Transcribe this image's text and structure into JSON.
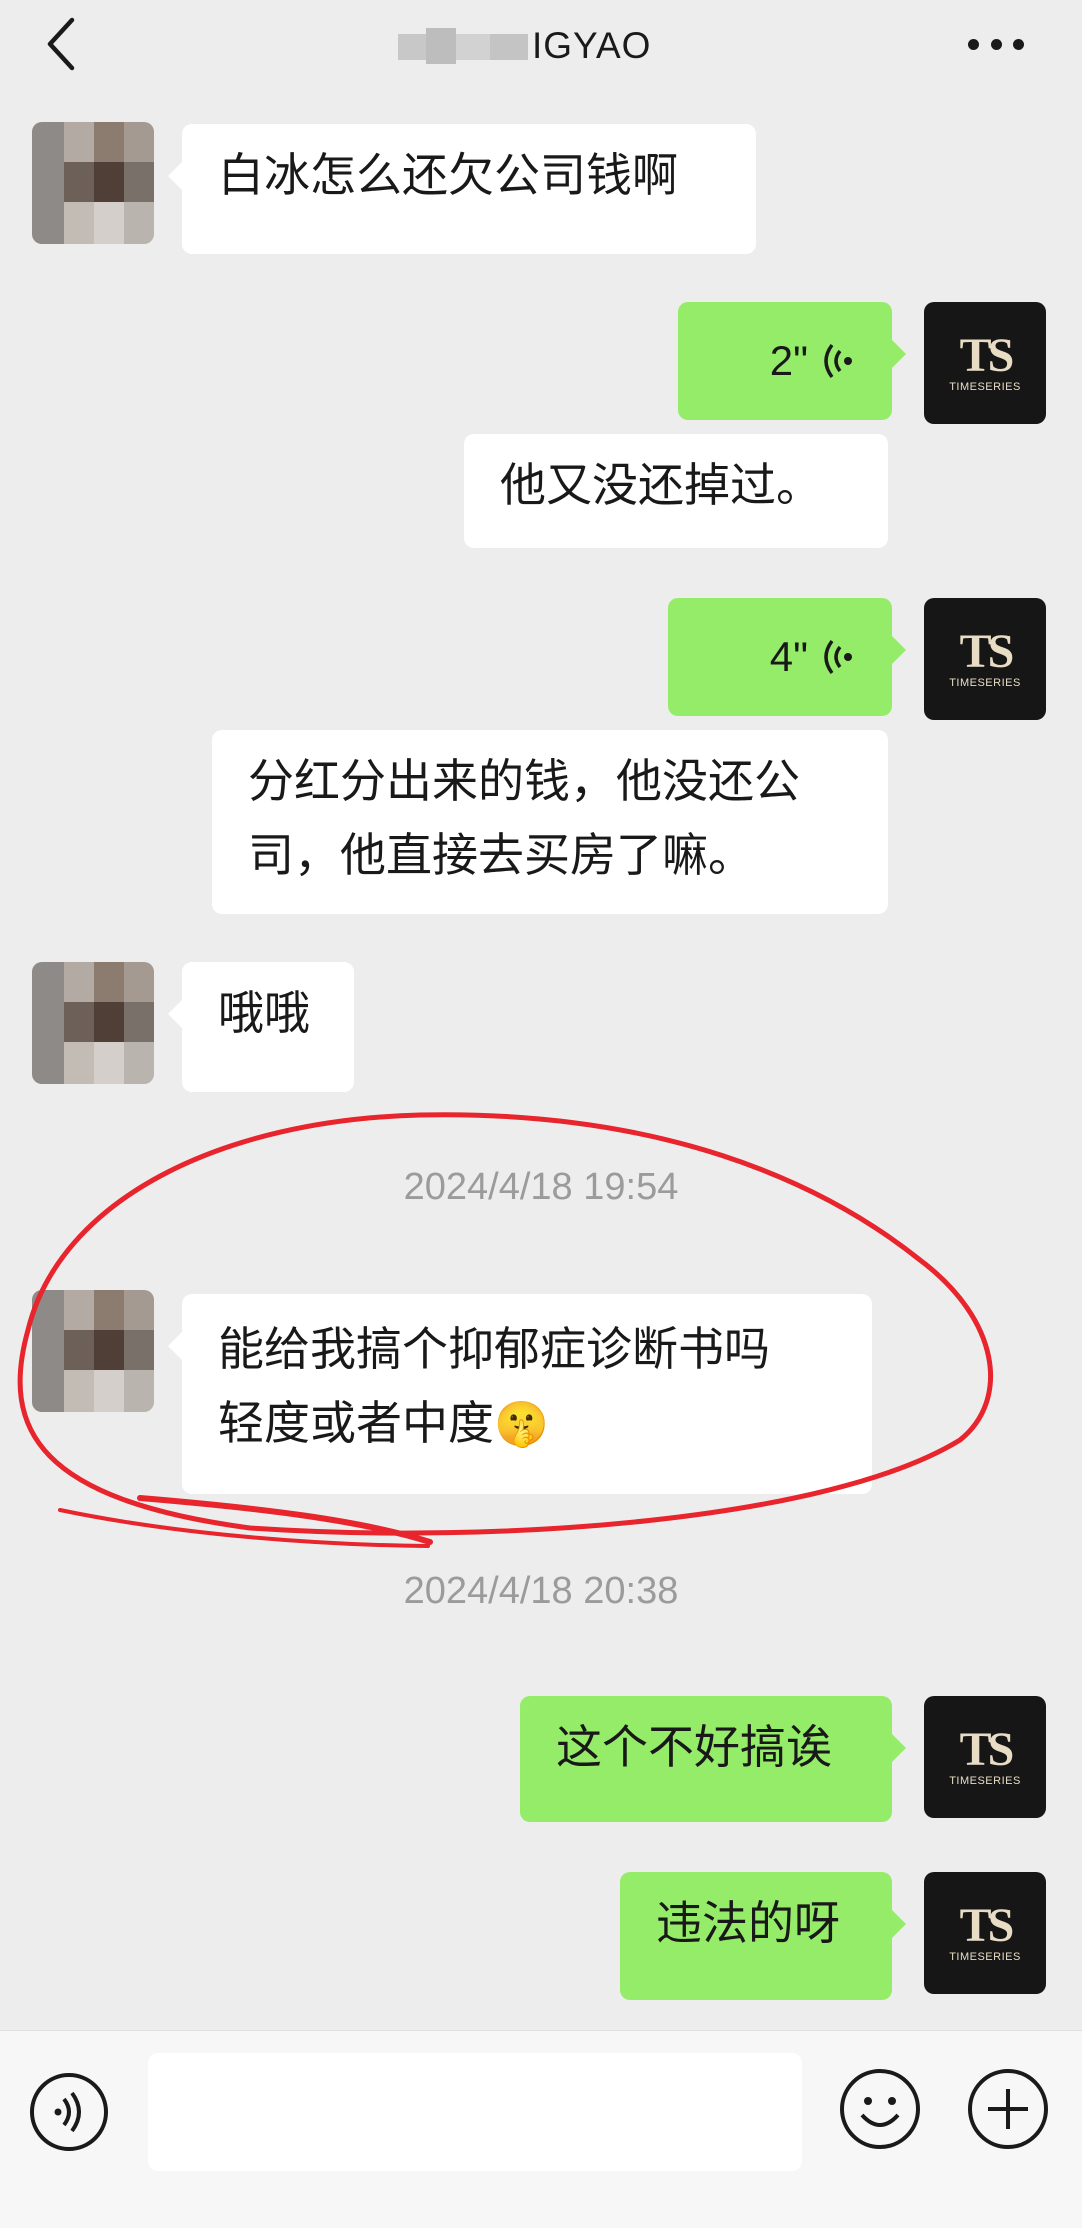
{
  "header": {
    "title_visible": "IGYAO",
    "back_icon": "chevron-left-icon",
    "more_icon": "more-dots-icon"
  },
  "avatars": {
    "self_logo": "TS",
    "self_logo_sub": "TIMESERIES"
  },
  "messages": [
    {
      "side": "in",
      "text": "白冰怎么还欠公司钱啊"
    },
    {
      "side": "out",
      "type": "voice",
      "duration": "2\""
    },
    {
      "side": "out",
      "type": "text-plain",
      "text": "他又没还掉过。"
    },
    {
      "side": "out",
      "type": "voice",
      "duration": "4\""
    },
    {
      "side": "out",
      "type": "text-plain",
      "text": "分红分出来的钱，他没还公司，他直接去买房了嘛。",
      "line1": "分红分出来的钱，他没还公",
      "line2": "司，他直接去买房了嘛。"
    },
    {
      "side": "in",
      "text": "哦哦"
    },
    {
      "type": "timestamp",
      "text": "2024/4/18 19:54"
    },
    {
      "side": "in",
      "text": "能给我搞个抑郁症诊断书吗轻度或者中度",
      "line1": "能给我搞个抑郁症诊断书吗",
      "line2": "轻度或者中度",
      "emoji": "🤫"
    },
    {
      "type": "timestamp",
      "text": "2024/4/18 20:38"
    },
    {
      "side": "out",
      "text": "这个不好搞诶"
    },
    {
      "side": "out",
      "text": "违法的呀"
    }
  ],
  "input_bar": {
    "voice_icon": "voice-mode-icon",
    "emoji_icon": "emoji-icon",
    "plus_icon": "plus-icon",
    "text_value": ""
  },
  "colors": {
    "background": "#ededed",
    "bubble_out": "#95ec69",
    "bubble_in": "#ffffff",
    "annotation": "#e8242c",
    "timestamp": "#9b9b9b"
  }
}
